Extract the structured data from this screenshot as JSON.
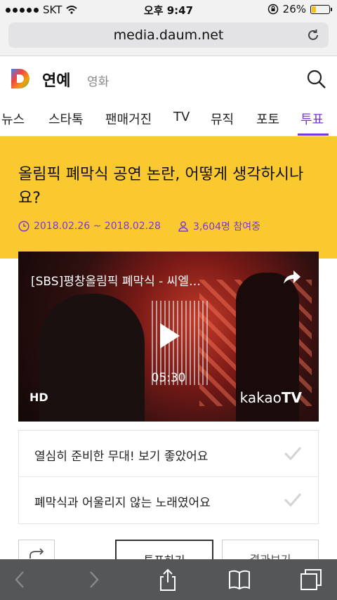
{
  "status_bar": {
    "carrier": "SKT",
    "time": "오후 9:47",
    "battery": "26%",
    "battery_level": 0.26
  },
  "browser": {
    "url": "media.daum.net",
    "reload_icon": "reload-icon"
  },
  "header": {
    "logo": "D",
    "section": "연예",
    "sub_link": "영화"
  },
  "tabs": [
    {
      "label": "뉴스",
      "active": false
    },
    {
      "label": "스타톡",
      "active": false
    },
    {
      "label": "팬매거진",
      "active": false
    },
    {
      "label": "TV",
      "active": false
    },
    {
      "label": "뮤직",
      "active": false
    },
    {
      "label": "포토",
      "active": false
    },
    {
      "label": "투표",
      "active": true
    }
  ],
  "vote": {
    "title": "올림픽 폐막식 공연 논란, 어떻게 생각하시나요?",
    "period": "2018.02.26 ~ 2018.02.28",
    "participants": "3,604명 참여중"
  },
  "video": {
    "title": "[SBS]평창올림픽 폐막식 - 씨엘…",
    "duration": "05:30",
    "quality": "HD",
    "brand_a": "kakao",
    "brand_b": "TV"
  },
  "options": [
    {
      "label": "열심히 준비한 무대! 보기 좋았어요"
    },
    {
      "label": "폐막식과 어울리지 않는 노래였어요"
    }
  ],
  "actions": {
    "vote_label": "투표하기",
    "result_label": "결과보기"
  },
  "colors": {
    "accent": "#7a38d8",
    "banner": "#f9c92f"
  }
}
